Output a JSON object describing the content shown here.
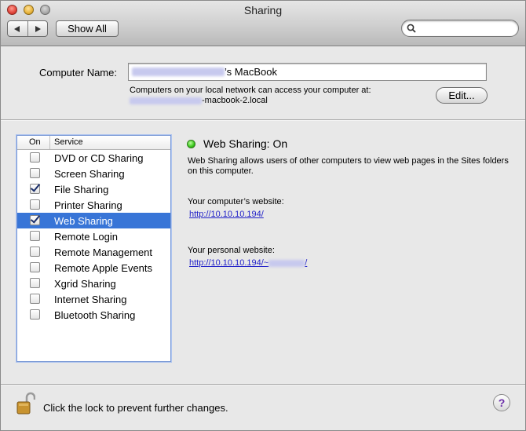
{
  "window": {
    "title": "Sharing"
  },
  "toolbar": {
    "show_all_label": "Show All",
    "search_placeholder": ""
  },
  "computer_name": {
    "label": "Computer Name:",
    "value_suffix": "’s MacBook",
    "info_line1": "Computers on your local network can access your computer at:",
    "info_line2_suffix": "-macbook-2.local",
    "edit_label": "Edit..."
  },
  "services": {
    "header_on": "On",
    "header_service": "Service",
    "items": [
      {
        "name": "DVD or CD Sharing",
        "checked": false,
        "selected": false
      },
      {
        "name": "Screen Sharing",
        "checked": false,
        "selected": false
      },
      {
        "name": "File Sharing",
        "checked": true,
        "selected": false
      },
      {
        "name": "Printer Sharing",
        "checked": false,
        "selected": false
      },
      {
        "name": "Web Sharing",
        "checked": true,
        "selected": true
      },
      {
        "name": "Remote Login",
        "checked": false,
        "selected": false
      },
      {
        "name": "Remote Management",
        "checked": false,
        "selected": false
      },
      {
        "name": "Remote Apple Events",
        "checked": false,
        "selected": false
      },
      {
        "name": "Xgrid Sharing",
        "checked": false,
        "selected": false
      },
      {
        "name": "Internet Sharing",
        "checked": false,
        "selected": false
      },
      {
        "name": "Bluetooth Sharing",
        "checked": false,
        "selected": false
      }
    ]
  },
  "detail": {
    "status": "Web Sharing: On",
    "status_color": "#38c51a",
    "description": "Web Sharing allows users of other computers to view web pages in the Sites folders on this computer.",
    "computer_site_label": "Your computer’s website:",
    "computer_site_url": "http://10.10.10.194/",
    "personal_site_label": "Your personal website:",
    "personal_site_url_prefix": "http://10.10.10.194/~",
    "personal_site_url_suffix": "/"
  },
  "footer": {
    "lock_text": "Click the lock to prevent further changes.",
    "help_label": "?"
  },
  "colors": {
    "selection": "#3875d7",
    "link": "#1f1fc8"
  }
}
